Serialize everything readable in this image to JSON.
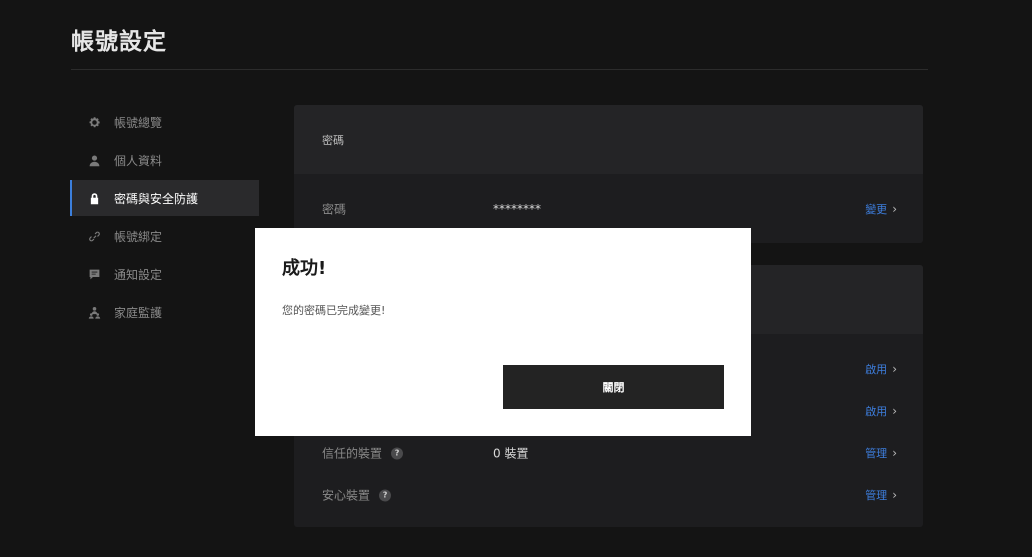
{
  "page": {
    "title": "帳號設定"
  },
  "sidebar": {
    "items": [
      {
        "label": "帳號總覽",
        "icon": "gear-icon",
        "active": false
      },
      {
        "label": "個人資料",
        "icon": "user-icon",
        "active": false
      },
      {
        "label": "密碼與安全防護",
        "icon": "lock-icon",
        "active": true
      },
      {
        "label": "帳號綁定",
        "icon": "link-icon",
        "active": false
      },
      {
        "label": "通知設定",
        "icon": "message-icon",
        "active": false
      },
      {
        "label": "家庭監護",
        "icon": "family-icon",
        "active": false
      }
    ]
  },
  "password_card": {
    "header": "密碼",
    "row": {
      "label": "密碼",
      "value": "********",
      "action": "變更",
      "chevron": "›"
    }
  },
  "security_card": {
    "rows": [
      {
        "label": "",
        "value": "",
        "action": "啟用",
        "chevron": "›"
      },
      {
        "label": "",
        "value": "",
        "action": "啟用",
        "chevron": "›"
      },
      {
        "label": "信任的裝置",
        "help": "?",
        "value": "0 裝置",
        "action": "管理",
        "chevron": "›"
      },
      {
        "label": "安心裝置",
        "help": "?",
        "value": "",
        "action": "管理",
        "chevron": "›"
      }
    ]
  },
  "dialog": {
    "title": "成功!",
    "message": "您的密碼已完成變更!",
    "button": "關閉"
  },
  "colors": {
    "background": "#141414",
    "card": "#1d1d1f",
    "card_header": "#242426",
    "accent": "#3c7fdc",
    "dialog_button": "#232323"
  }
}
